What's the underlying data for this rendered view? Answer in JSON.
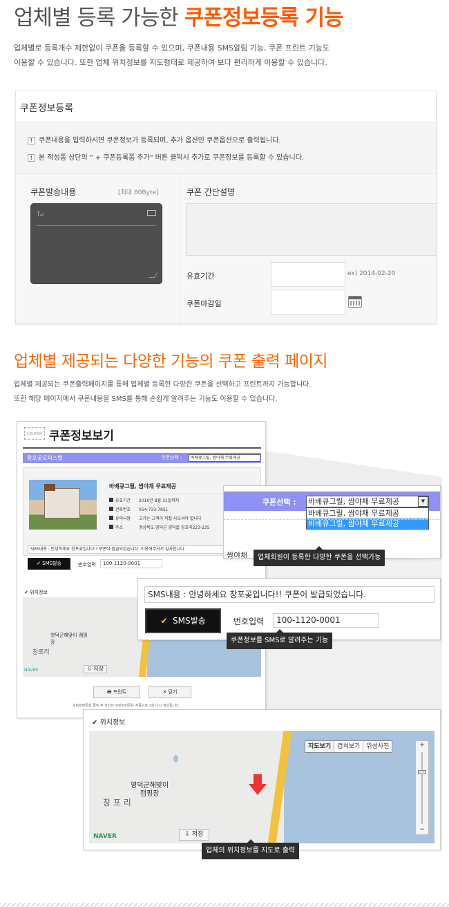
{
  "header": {
    "title_plain": "업체별 등록 가능한",
    "title_accent": "쿠폰정보등록 기능",
    "desc_line1": "업체별로 등록개수 제한없이 쿠폰을 등록할 수 있으며, 쿠폰내용 SMS알림 기능, 쿠폰 프린트 기능도",
    "desc_line2": "이용할 수 있습니다. 또한 업체 위치정보를 지도형태로 제공하여 보다 편리하게 이용할 수 있습니다."
  },
  "form": {
    "title": "쿠폰정보등록",
    "notice1": "쿠폰내용을 입력하시면 쿠폰정보가 등록되며, 추가 옵션인 쿠폰옵션으로 출력됩니다.",
    "notice2": "본 작성폼 상단의 \" + 쿠폰등록폼 추가\" 버튼 클릭시 추가로 쿠폰정보를 등록할 수 있습니다.",
    "send_label": "쿠폰발송내용",
    "send_limit": "[최대 80Byte]",
    "desc_label": "쿠폰 간단설명",
    "valid_label": "유효기간",
    "valid_example": "ex) 2014-02-20",
    "deadline_label": "쿠폰마감일"
  },
  "section2": {
    "title": "업체별 제공되는 다양한 기능의 쿠폰 출력 페이지",
    "desc_line1": "업체별 제공되는 쿠폰출력페이지를 통해 업체별 등록한 다양한 쿠폰을 선택하고 프린트까지 가능합니다.",
    "desc_line2": "또한 해당 페이지에서 쿠폰내용을 SMS를 통해 손쉽게 알려주는 기능도 이용할 수 있습니다."
  },
  "coupon_view": {
    "logo": "COUPON",
    "title": "쿠폰정보보기",
    "store_name": "창포곶오피스텔",
    "select_label": "쿠폰선택 :",
    "select_value": "바베큐그릴, 쌈야채 무료제공",
    "item_title": "바베큐그릴, 쌈야채 무료제공",
    "rows": [
      {
        "key": "유효기간",
        "value": "2010년 8월 31일까지"
      },
      {
        "key": "전화번호",
        "value": "054-733-7851"
      },
      {
        "key": "유의사항",
        "value": "고가는 고객이 직접 사오셔야 합니다"
      },
      {
        "key": "주소",
        "value": "경상북도 영덕군 영덕읍 창포리223-225"
      }
    ],
    "sms_content": "SMS내용 : 안녕하세요 창포곶입니다!! 쿠폰이 발급되었습니다. 이용해주셔서 감사합니다.",
    "sms_button": "SMS발송",
    "phone_label": "번호입력",
    "phone_value": "100-1120-0001",
    "location_label": "위치정보",
    "map_place": "영덕군해맞이 캠핑장",
    "map_village": "창포리",
    "map_brand": "NAVER",
    "save_button": "저장",
    "print_button": "프린트",
    "close_button": "닫기",
    "footer_note": "프린트버튼을 클릭 후 사라진 프린트버튼은 자동으로 1회 다시 생성됩니다."
  },
  "zoom_select": {
    "label": "쿠폰선택 :",
    "value": "바베큐그릴, 쌈야채 무료제공",
    "options": [
      "바베큐그릴, 쌈야채 무료제공",
      "바베큐그릴, 쌈야채 무료제공"
    ],
    "behind_text": "쌈야채",
    "tooltip": "업체회원이 등록한 다양한 쿠폰을 선택가능"
  },
  "zoom_sms": {
    "content": "SMS내용 : 안녕하세요 창포곶입니다!! 쿠폰이 발급되었습니다.",
    "button": "SMS발송",
    "phone_label": "번호입력",
    "phone_value": "100-1120-0001",
    "tooltip": "쿠폰정보를 SMS로 알려주는 기능"
  },
  "zoom_map": {
    "label": "위치정보",
    "tabs": [
      "지도보기",
      "겹쳐보기",
      "위성사진"
    ],
    "place_line1": "영덕군해맞이",
    "place_line2": "캠핑장",
    "village": "창 포 리",
    "brand": "NAVER",
    "save": "저장",
    "tooltip": "업체의 위치정보를 지도로 출력"
  },
  "colors": {
    "accent": "#ff5a00",
    "orange_title": "#ff6600",
    "purple_bar": "#8f91f3",
    "dark_btn": "#111111"
  }
}
